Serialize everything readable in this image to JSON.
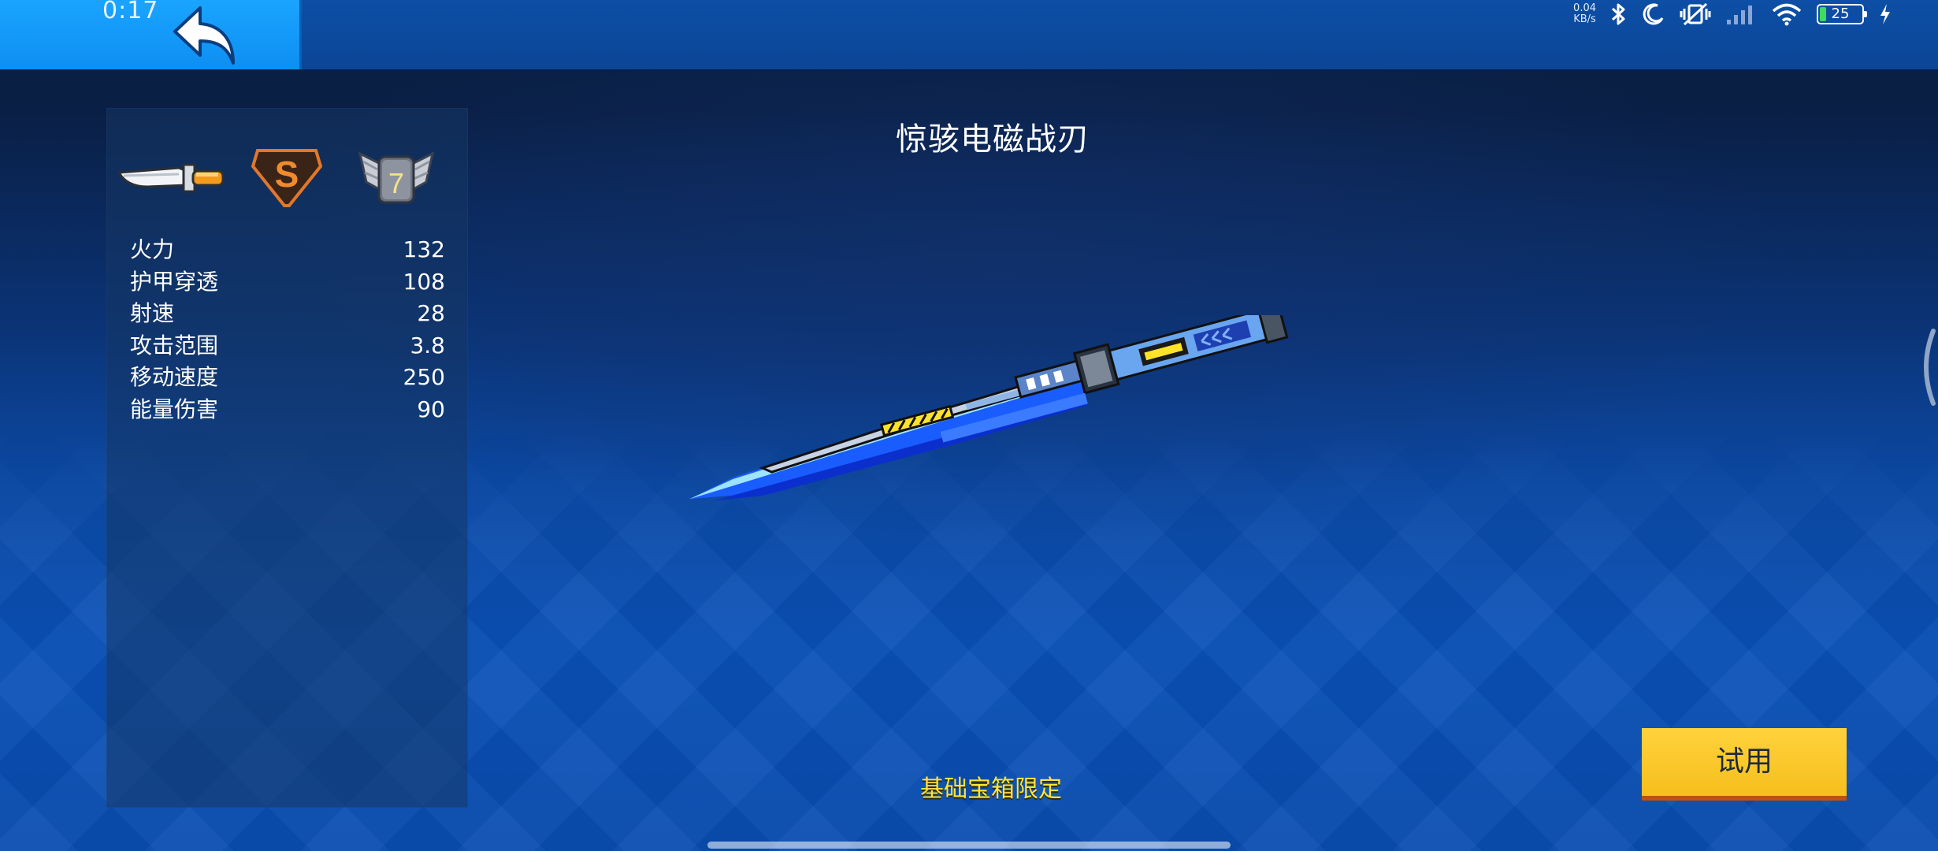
{
  "status_bar": {
    "time": "0:17",
    "net_speed_value": "0.04",
    "net_speed_unit": "KB/s",
    "battery_level": "25",
    "icons": [
      "bluetooth-icon",
      "moon-icon",
      "vibrate-icon",
      "signal-icon",
      "wifi-icon",
      "battery-icon",
      "charging-icon"
    ]
  },
  "header": {
    "back_icon": "back-arrow-icon"
  },
  "weapon": {
    "name": "惊骇电磁战刃",
    "category_icon": "knife-icon",
    "rarity": "S",
    "level": "7",
    "source_note": "基础宝箱限定"
  },
  "stats": [
    {
      "name": "火力",
      "value": "132"
    },
    {
      "name": "护甲穿透",
      "value": "108"
    },
    {
      "name": "射速",
      "value": "28"
    },
    {
      "name": "攻击范围",
      "value": "3.8"
    },
    {
      "name": "移动速度",
      "value": "250"
    },
    {
      "name": "能量伤害",
      "value": "90"
    }
  ],
  "actions": {
    "try_label": "试用"
  },
  "colors": {
    "accent_blue": "#1aa4ff",
    "button_yellow": "#f6bf1c",
    "note_yellow": "#ffe43a",
    "rarity_orange": "#e2782a"
  }
}
